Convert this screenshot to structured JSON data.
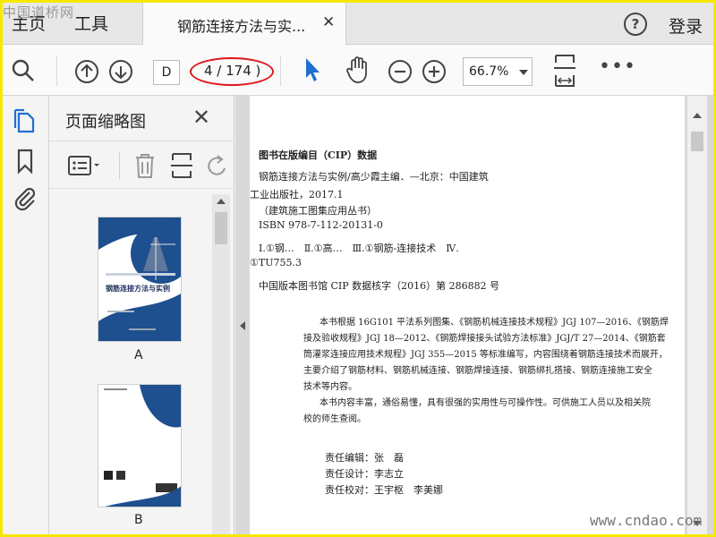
{
  "watermark": {
    "top_left": "中国道桥网",
    "bottom_right": "www.cndao.com"
  },
  "tabs": {
    "home": "主页",
    "tools": "工具",
    "document_title": "钢筋连接方法与实...",
    "close": "✕"
  },
  "header": {
    "help": "?",
    "login": "登录"
  },
  "toolbar": {
    "page_input": "D",
    "page_count": "4 / 174 )",
    "zoom": "66.7%",
    "more": "•••"
  },
  "panel": {
    "title": "页面缩略图",
    "close": "✕",
    "thumbnails": [
      {
        "label": "A",
        "cover_title": "钢筋连接方法与实例"
      },
      {
        "label": "B"
      }
    ]
  },
  "page_content": {
    "heading": "图书在版编目（CIP）数据",
    "lines": [
      "钢筋连接方法与实例/高少霞主编．—北京：中国建筑",
      "工业出版社，2017.1",
      "（建筑施工图集应用丛书）",
      "ISBN 978-7-112-20131-0",
      "Ⅰ.①钢…　Ⅱ.①高…　Ⅲ.①钢筋-连接技术　Ⅳ.",
      "①TU755.3"
    ],
    "cip_note": "中国版本图书馆 CIP 数据核字（2016）第 286882 号",
    "intro": [
      "本书根据 16G101 平法系列图集、《钢筋机械连接技术规程》JGJ 107—2016、《钢筋焊",
      "接及验收规程》JGJ 18—2012、《钢筋焊接接头试验方法标准》JGJ/T 27—2014、《钢筋套",
      "筒灌浆连接应用技术规程》JGJ 355—2015 等标准编写，内容围绕着钢筋连接技术而展开，",
      "主要介绍了钢筋材料、钢筋机械连接、钢筋焊接连接、钢筋绑扎搭接、钢筋连接施工安全",
      "技术等内容。",
      "本书内容丰富，通俗易懂，具有很强的实用性与可操作性。可供施工人员以及相关院",
      "校的师生查阅。"
    ],
    "credits": [
      "责任编辑：张　磊",
      "责任设计：李志立",
      "责任校对：王宇枢　李美娜"
    ]
  },
  "colors": {
    "accent_blue": "#1f6fd1",
    "annotation_red": "#e0151b",
    "cover_blue": "#1e4f8f"
  }
}
